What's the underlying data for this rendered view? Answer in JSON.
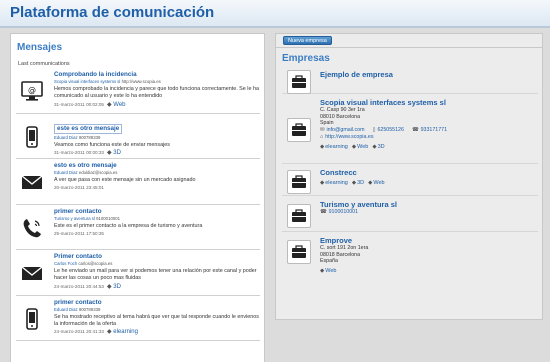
{
  "app": {
    "title": "Plataforma de comunicación"
  },
  "messages": {
    "title": "Mensajes",
    "subtitle": "Last communications",
    "items": [
      {
        "icon": "computer-icon",
        "title": "Comprobando la incidencia",
        "from": "Scopia visual interfaces systems sl",
        "extra": "http://www.scopia.es",
        "text": "Hemos comprobado la incidencia y parece que todo funciona correctamente. Se le ha comunicado al usuario y este lo ha entendido",
        "date": "31-marzo-2011 00:02:05",
        "tags": [
          {
            "icon": "tag-icon",
            "label": "Web"
          }
        ]
      },
      {
        "icon": "mobile-icon",
        "title": "este es otro mensaje",
        "from": "Eduard Diaz",
        "extra": "900789339",
        "text": "Veamos como funciona este de enviar mensajes",
        "date": "31-marzo-2011 00:00:33",
        "tags": [
          {
            "icon": "tag-icon",
            "label": "3D"
          }
        ]
      },
      {
        "icon": "envelope-icon",
        "title": "esto es otro mensaje",
        "from": "Eduard Diaz",
        "extra": "eduldiaz@scopia.es",
        "text": "A ver que pasa con este mensaje sin un mercado asignado",
        "date": "20-marzo-2011 23:45:01",
        "tags": []
      },
      {
        "icon": "phone-icon",
        "title": "primer contacto",
        "from": "Turismo y aventura sl",
        "extra": "9100010001",
        "text": "Este es el primer contacto a la empresa de turismo y aventura",
        "date": "25-marzo-2011 17:50:35",
        "tags": []
      },
      {
        "icon": "envelope-icon",
        "title": "Primer contacto",
        "from": "Carlos Foch",
        "extra": "carlos@scopia.es",
        "text": "Le he enviado un mail para ver si podemos tener una relación por este canal y poder hacer las cosas un poco mas fluidas",
        "date": "24-marzo-2011 20:44:53",
        "tags": [
          {
            "icon": "tag-icon",
            "label": "3D"
          }
        ]
      },
      {
        "icon": "mobile-icon",
        "title": "primer contacto",
        "from": "Eduard Diaz",
        "extra": "900789339",
        "text": "Se ha mostrado receptivo al tema habrá que ver que tal responde cuando le envienos la información de la oferta",
        "date": "24-marzo-2011 20:41:33",
        "tags": [
          {
            "icon": "tag-icon",
            "label": "elearning"
          }
        ]
      }
    ]
  },
  "companies": {
    "button_label": "Nueva empresa",
    "title": "Empresas",
    "items": [
      {
        "name": "Ejemplo de empresa",
        "address": [],
        "contacts": [],
        "tags": []
      },
      {
        "name": "Scopia visual interfaces systems sl",
        "address": [
          "C. Casp 90 3er 1ra",
          "08010 Barcelona",
          "Spain"
        ],
        "contacts": [
          {
            "icon": "email-icon",
            "value": "info@gmail.com"
          },
          {
            "icon": "mobile-icon",
            "value": "625055126"
          },
          {
            "icon": "phone-icon",
            "value": "933171771"
          },
          {
            "icon": "web-icon",
            "value": "http://www.scopia.es"
          }
        ],
        "tags": [
          {
            "icon": "tag-icon",
            "label": "elearning"
          },
          {
            "icon": "tag-icon",
            "label": "Web"
          },
          {
            "icon": "tag-icon",
            "label": "3D"
          }
        ]
      },
      {
        "name": "Constrecc",
        "address": [],
        "contacts": [],
        "tags": [
          {
            "icon": "tag-icon",
            "label": "elearning"
          },
          {
            "icon": "tag-icon",
            "label": "3D"
          },
          {
            "icon": "tag-icon",
            "label": "Web"
          }
        ]
      },
      {
        "name": "Turismo y aventura sl",
        "address": [],
        "contacts": [
          {
            "icon": "phone-icon",
            "value": "9100010001"
          }
        ],
        "tags": []
      },
      {
        "name": "Emprove",
        "address": [
          "C. sort 191 2on 1era",
          "08018 Barcelona",
          "España"
        ],
        "contacts": [],
        "tags": [
          {
            "icon": "tag-icon",
            "label": "Web"
          }
        ]
      }
    ]
  },
  "colors": {
    "accent": "#1f5fa8",
    "heading": "#3c7ec4",
    "button": "#2f6fb0"
  }
}
